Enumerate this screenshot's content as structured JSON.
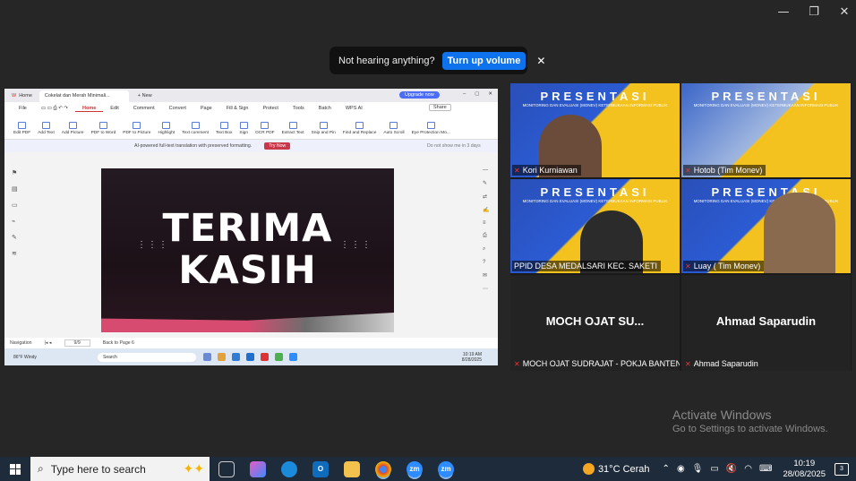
{
  "notification": {
    "message": "Not hearing anything?",
    "action": "Turn up volume",
    "close": "✕"
  },
  "window_controls": {
    "minimize": "—",
    "restore": "❐",
    "close": "✕"
  },
  "shared_screen": {
    "tabs": {
      "home": "Home",
      "doc": "Cokelat dan Merah Minimali...",
      "new": "New",
      "upgrade": "Upgrade now"
    },
    "menu": [
      "File",
      "Home",
      "Edit",
      "Comment",
      "Convert",
      "Page",
      "Fill & Sign",
      "Protect",
      "Tools",
      "Batch",
      "WPS AI"
    ],
    "menu_active": "Home",
    "share_label": "Share",
    "ribbon": [
      "Edit PDF",
      "Add Text",
      "Add Picture",
      "PDF to Word",
      "PDF to Picture",
      "Highlight",
      "Text comment",
      "Text Box",
      "Sign",
      "OCR PDF",
      "Extract Text",
      "Snip and Pin",
      "Find and Replace",
      "Auto Scroll",
      "Eye Protection Mo..."
    ],
    "ai_bar": {
      "text": "AI-powered full-text translation with preserved formatting.",
      "try": "Try Now",
      "dont": "Do not show me in 3 days"
    },
    "slide": {
      "line1": "TERIMA",
      "line2": "KASIH",
      "dots": "⠿"
    },
    "status": {
      "nav": "Navigation",
      "page": "9/9",
      "back": "Back to Page 6"
    },
    "mini_taskbar": {
      "weather": "86°F Windy",
      "search": "Search",
      "time": "10:19 AM",
      "date": "8/28/2025"
    }
  },
  "participants": [
    {
      "name": "Kori Kurniawan",
      "type": "video",
      "active": false
    },
    {
      "name": "Hotob (Tim Monev)",
      "type": "video",
      "active": false
    },
    {
      "name": "PPID DESA MEDALSARI KEC. SAKETI",
      "type": "video",
      "active": true
    },
    {
      "name": "Luay ( Tim Monev)",
      "type": "video",
      "active": false
    },
    {
      "name": "MOCH OJAT SUDRAJAT - POKJA BANTEN",
      "display": "MOCH OJAT SU...",
      "type": "no-video"
    },
    {
      "name": "Ahmad Saparudin",
      "display": "Ahmad Saparudin",
      "type": "no-video"
    }
  ],
  "slide_header": {
    "title": "PRESENTASI",
    "subtitle": "MONITORING DAN EVALUASI (MONEV) KETERBUKAAN INFORMASI PUBLIK"
  },
  "watermark": {
    "title": "Activate Windows",
    "subtitle": "Go to Settings to activate Windows."
  },
  "taskbar": {
    "search_placeholder": "Type here to search",
    "weather": "31°C  Cerah",
    "time": "10:19",
    "date": "28/08/2025",
    "notifications": "3"
  },
  "colors": {
    "accent": "#0e72ed",
    "active_speaker": "#35c85a",
    "mic_muted": "#e33333"
  }
}
